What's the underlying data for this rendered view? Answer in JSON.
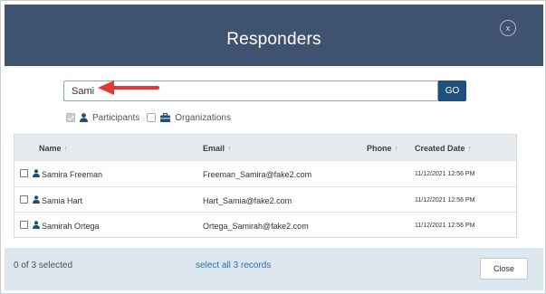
{
  "header": {
    "title": "Responders",
    "close_glyph": "x"
  },
  "search": {
    "value": "Sami",
    "go_label": "GO"
  },
  "filters": [
    {
      "label": "Participants",
      "checked": true,
      "icon": "person-icon"
    },
    {
      "label": "Organizations",
      "checked": false,
      "icon": "briefcase-icon"
    }
  ],
  "table": {
    "columns": {
      "name": "Name",
      "email": "Email",
      "phone": "Phone",
      "created": "Created Date",
      "sort_glyph": "↑"
    },
    "rows": [
      {
        "name": "Samira Freeman",
        "email": "Freeman_Samira@fake2.com",
        "phone": "",
        "created": "11/12/2021 12:56 PM"
      },
      {
        "name": "Samia Hart",
        "email": "Hart_Samia@fake2.com",
        "phone": "",
        "created": "11/12/2021 12:56 PM"
      },
      {
        "name": "Samirah Ortega",
        "email": "Ortega_Samirah@fake2.com",
        "phone": "",
        "created": "11/12/2021 12:56 PM"
      }
    ]
  },
  "footer": {
    "selected_text": "0 of 3 selected",
    "select_all_text": "select all 3 records",
    "close_label": "Close"
  },
  "colors": {
    "header_bg": "#3f5370",
    "go_button": "#1e4f7d",
    "annotation_arrow": "#e53935",
    "footer_bg": "#dce7ef",
    "link": "#2d6fa7",
    "person_icon": "#1d4f79"
  }
}
